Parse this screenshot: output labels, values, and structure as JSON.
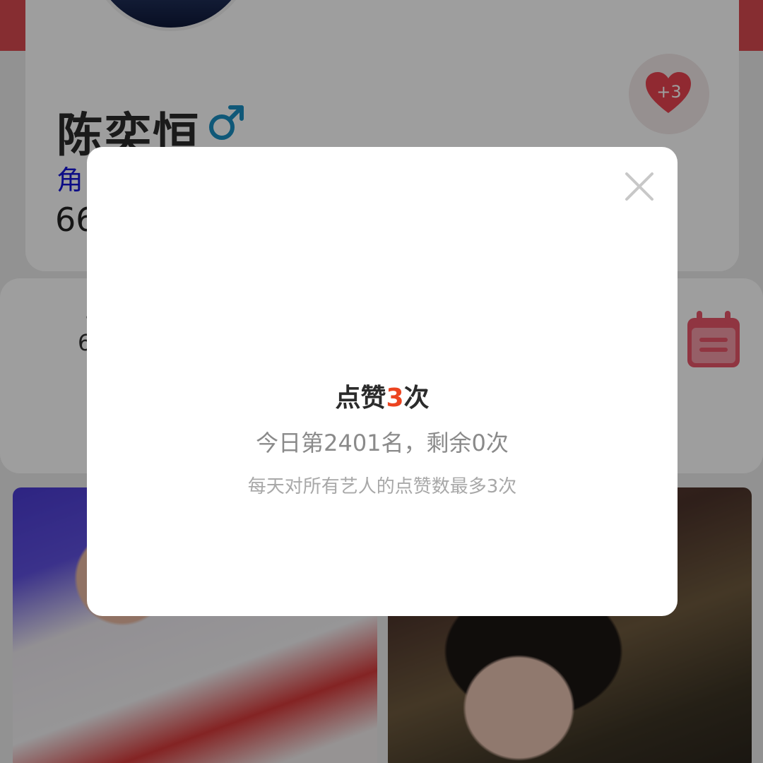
{
  "profile": {
    "name": "陈奕恒",
    "gender_symbol": "♂",
    "role_prefix": "角",
    "stat_prefix": "66",
    "like_button": {
      "count_label": "+3",
      "icon": "heart-icon"
    }
  },
  "second_card": {
    "dot": "·",
    "stat_prefix": "6",
    "icon": "calendar-icon"
  },
  "dialog": {
    "title_before": "点赞",
    "title_count": "3",
    "title_after": "次",
    "rank_text": "今日第2401名，剩余0次",
    "note_text": "每天对所有艺人的点赞数最多3次",
    "close_icon": "close-icon"
  },
  "colors": {
    "accent": "#ec4420",
    "heart": "#e8434f",
    "gender": "#1a8fc2",
    "role": "#1616d8",
    "calendar": "#e8566a"
  }
}
